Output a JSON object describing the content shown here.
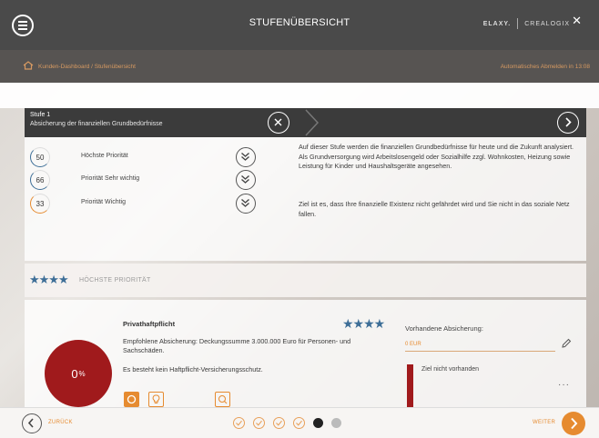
{
  "header": {
    "title": "STUFENÜBERSICHT",
    "brand_1": "ELAXY.",
    "brand_2": "CREALOGIX"
  },
  "subbar": {
    "breadcrumb": "Kunden-Dashboard /  Stufenübersicht",
    "logout_note": "Automatisches Abmelden in 13:08"
  },
  "level": {
    "number": "Stufe 1",
    "description": "Absicherung der finanziellen Grundbedürfnisse",
    "priorities": [
      {
        "value": "50",
        "label": "Höchste Priorität",
        "color": "#3d6e97"
      },
      {
        "value": "66",
        "label": "Priorität Sehr wichtig",
        "color": "#3d6e97"
      },
      {
        "value": "33",
        "label": "Priorität Wichtig",
        "color": "#e68b30"
      }
    ],
    "text_1": "Auf dieser Stufe werden die finanziellen Grundbedürfnisse für heute und die Zukunft analysiert. Als Grundversorgung wird Arbeitslosengeld oder Sozialhilfe zzgl. Wohnkosten, Heizung sowie Leistung für Kinder und Haushaltsgeräte angesehen.",
    "text_2": "Ziel ist es, dass Ihre finanzielle Existenz nicht gefährdet wird und Sie nicht in das soziale Netz fallen."
  },
  "section": {
    "stars": "★★★★",
    "title": "HÖCHSTE PRIORITÄT"
  },
  "product": {
    "coverage_percent": "0",
    "percent_sign": "%",
    "title": "Privathaftpflicht",
    "stars": "★★★★",
    "recommendation": "Empfohlene Absicherung: Deckungssumme 3.000.000 Euro für Personen- und Sachschäden.",
    "status": "Es besteht kein Haftpflicht-Versicherungsschutz.",
    "existing_label": "Vorhandene Absicherung:",
    "existing_value": "0 EUR",
    "goal_text": "Ziel nicht vorhanden",
    "more": "···"
  },
  "footer": {
    "back_label": "ZURÜCK",
    "next_label": "WEITER",
    "steps": [
      "done",
      "done",
      "done",
      "done",
      "current",
      "future"
    ]
  },
  "colors": {
    "accent": "#e68b30",
    "danger": "#a01a1c",
    "star_blue": "#3d6e97",
    "dark_bar": "#3b3b3b"
  }
}
